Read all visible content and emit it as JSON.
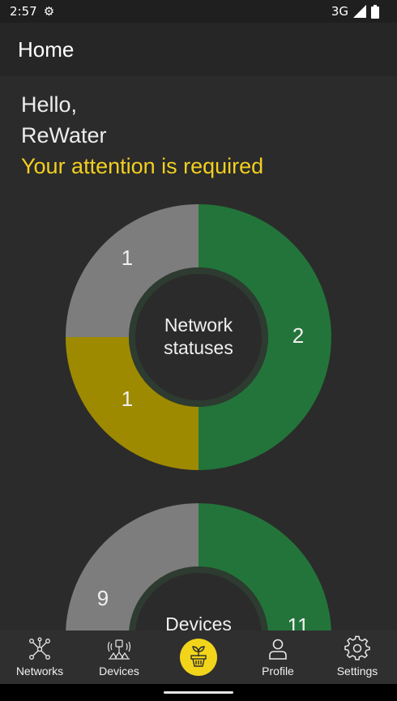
{
  "status_bar": {
    "time": "2:57",
    "network": "3G",
    "icons": [
      "settings-gear-icon",
      "signal-icon",
      "battery-icon"
    ]
  },
  "app_bar": {
    "title": "Home"
  },
  "greeting": {
    "hello": "Hello,",
    "name": "ReWater",
    "alert": "Your attention is required"
  },
  "colors": {
    "green": "#23743a",
    "gray": "#7d7d7d",
    "olive": "#9e8a00",
    "accent": "#f2d51a"
  },
  "charts": {
    "network": {
      "center_line1": "Network",
      "center_line2": "statuses",
      "green": "2",
      "gray": "1",
      "olive": "1"
    },
    "devices": {
      "center_line1": "Devices",
      "green": "11",
      "gray": "9"
    }
  },
  "chart_data": [
    {
      "type": "pie",
      "title": "Network statuses",
      "values": [
        2,
        1,
        1
      ],
      "colors": [
        "#23743a",
        "#9e8a00",
        "#7d7d7d"
      ]
    },
    {
      "type": "pie",
      "title": "Devices",
      "values": [
        11,
        9
      ],
      "colors": [
        "#23743a",
        "#7d7d7d"
      ]
    }
  ],
  "nav": {
    "networks": "Networks",
    "devices": "Devices",
    "center_icon": "plant-pot-icon",
    "profile": "Profile",
    "settings": "Settings"
  }
}
